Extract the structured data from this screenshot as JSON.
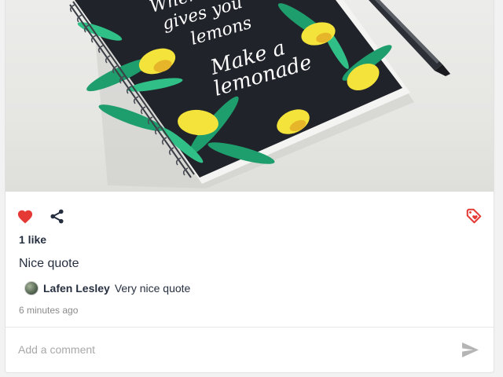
{
  "post": {
    "likes_text": "1 like",
    "caption": "Nice quote",
    "comment": {
      "author": "Lafen Lesley",
      "text": "Very nice quote"
    },
    "timestamp": "6 minutes ago",
    "notebook_text": {
      "line1": "When life",
      "line2": "gives you",
      "line3": "lemons",
      "line4": "Make a",
      "line5": "lemonade"
    }
  },
  "comment_box": {
    "placeholder": "Add a comment"
  },
  "icons": {
    "like": "heart-icon",
    "share": "share-icon",
    "save": "tag-heart-icon",
    "send": "send-icon"
  },
  "colors": {
    "like": "#e53935",
    "text": "#262f40",
    "muted": "#8a8a8a",
    "send": "#b5b5b5"
  }
}
